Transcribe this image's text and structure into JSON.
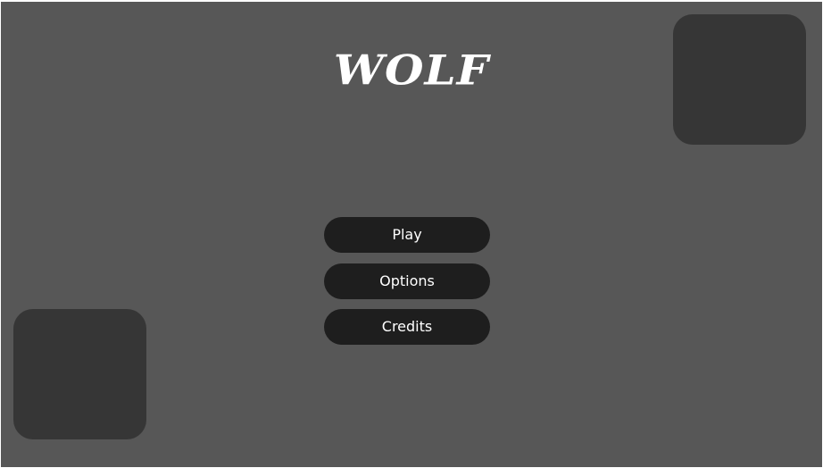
{
  "game": {
    "title": "WOLF"
  },
  "menu": {
    "buttons": [
      {
        "label": "Play"
      },
      {
        "label": "Options"
      },
      {
        "label": "Credits"
      }
    ]
  },
  "colors": {
    "background": "#575757",
    "panel": "#363636",
    "button": "#1e1e1e",
    "text": "#ffffff"
  }
}
